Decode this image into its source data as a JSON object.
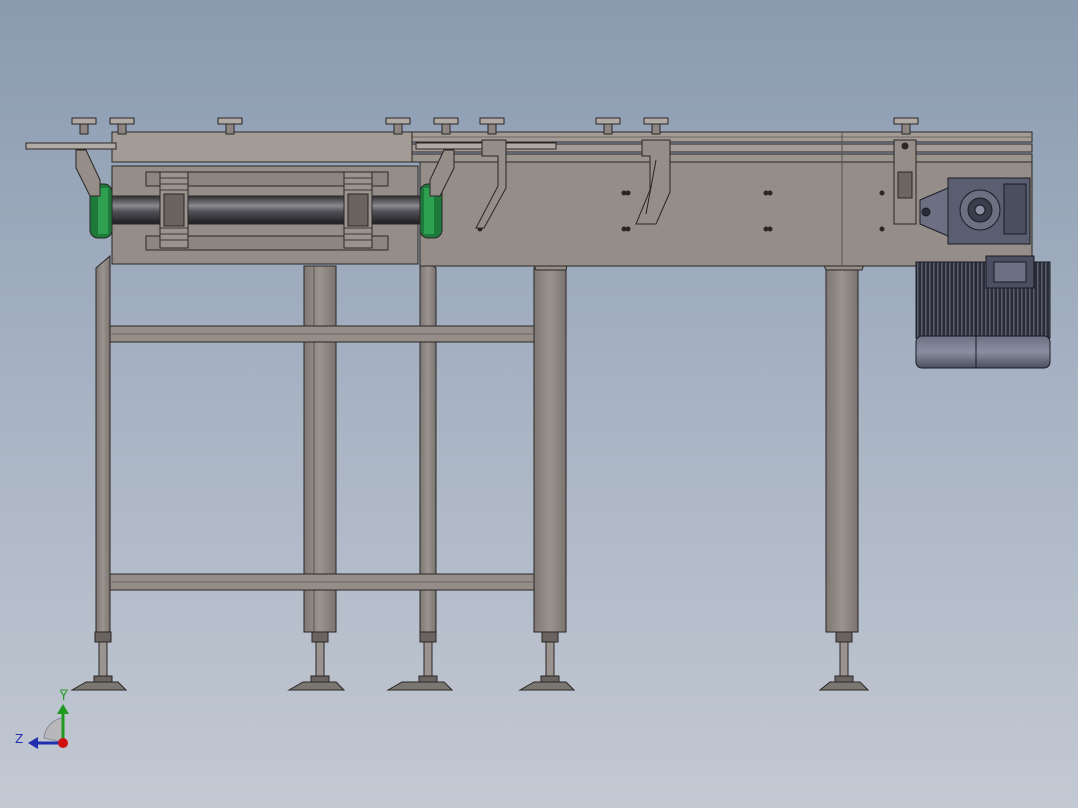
{
  "view": {
    "background_top": "#8a9bb0",
    "background_bottom": "#c3c9d3",
    "description_icon": "conveyor-assembly-side-view"
  },
  "triad": {
    "y_label": "Y",
    "z_label": "Z",
    "y_color": "#1f9a1f",
    "z_color": "#1f2fb0",
    "x_color": "#d01010"
  },
  "colors": {
    "frame_fill": "#8c8580",
    "frame_stroke": "#2a2624",
    "plate_fill": "#958e88",
    "roller_dark": "#3c3c40",
    "sprocket": "#7a7470",
    "end_cap": "#1e7a3a",
    "motor_body": "#5a5e70",
    "motor_dark": "#2a2c38",
    "foot": "#7a7672"
  }
}
